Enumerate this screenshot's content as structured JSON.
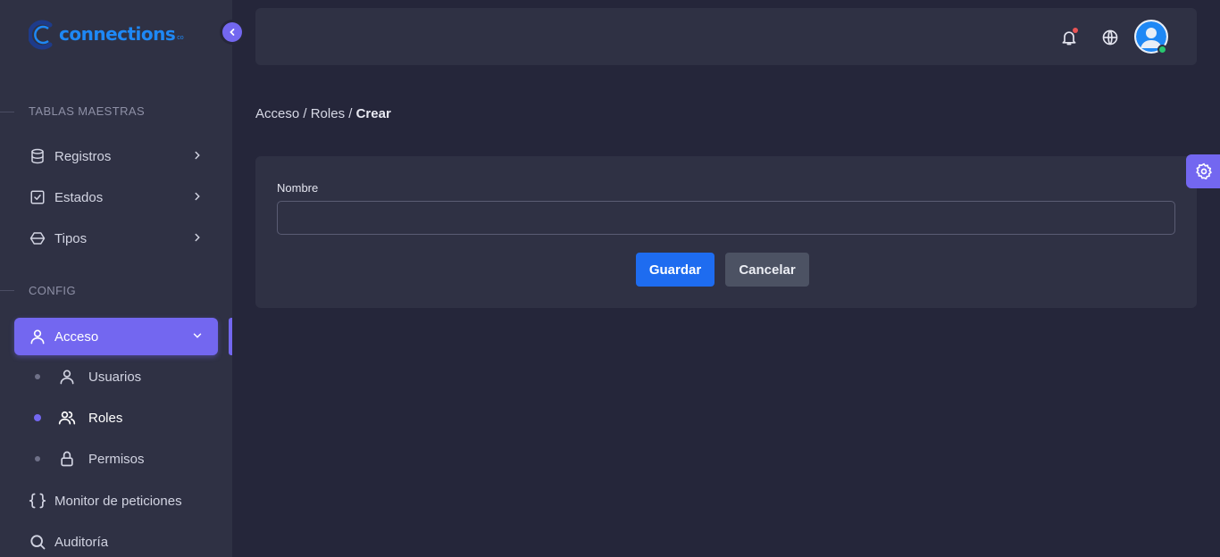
{
  "brand": {
    "name": "connections",
    "suffix": "co"
  },
  "sidebar": {
    "sections": [
      {
        "title": "TABLAS MAESTRAS"
      },
      {
        "title": "CONFIG"
      }
    ],
    "items": [
      {
        "label": "Registros",
        "icon": "database-icon"
      },
      {
        "label": "Estados",
        "icon": "checkbox-icon"
      },
      {
        "label": "Tipos",
        "icon": "box-icon"
      },
      {
        "label": "Acceso",
        "icon": "user-icon",
        "active": true
      },
      {
        "label": "Monitor de peticiones",
        "icon": "braces-icon"
      },
      {
        "label": "Auditoría",
        "icon": "search-icon"
      }
    ],
    "subitems": [
      {
        "label": "Usuarios",
        "icon": "user-icon"
      },
      {
        "label": "Roles",
        "icon": "users-icon",
        "active": true
      },
      {
        "label": "Permisos",
        "icon": "lock-icon"
      }
    ]
  },
  "topbar": {
    "icons": [
      "bell-icon",
      "globe-icon",
      "avatar"
    ]
  },
  "breadcrumb": {
    "part1": "Acceso",
    "sep": " / ",
    "part2": "Roles",
    "current": "Crear"
  },
  "form": {
    "name_label": "Nombre",
    "name_value": "",
    "save_label": "Guardar",
    "cancel_label": "Cancelar"
  },
  "colors": {
    "accent": "#7367f0",
    "primary": "#1e6cf0",
    "background": "#25263a",
    "panel": "#2f3144"
  }
}
